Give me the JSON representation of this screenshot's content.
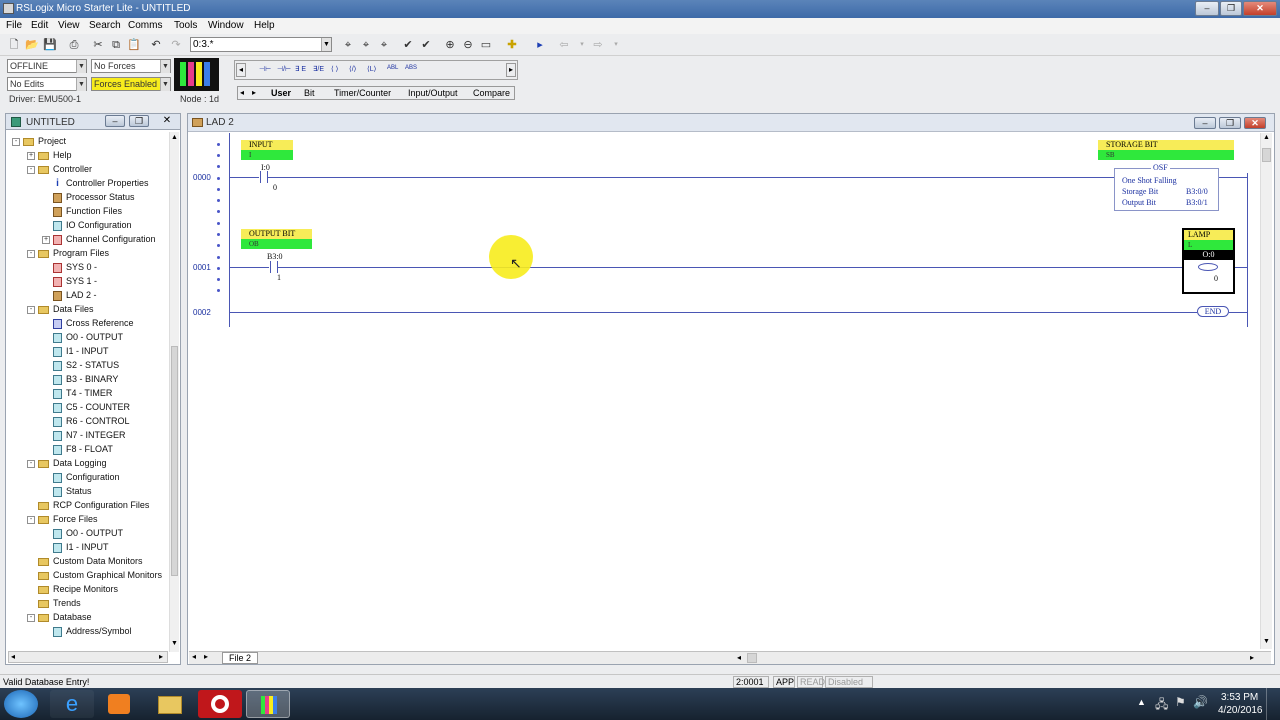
{
  "window": {
    "title": "RSLogix Micro Starter Lite - UNTITLED"
  },
  "menu": [
    "File",
    "Edit",
    "View",
    "Search",
    "Comms",
    "Tools",
    "Window",
    "Help"
  ],
  "toolbar": {
    "address_value": "0:3.*"
  },
  "status_panel": {
    "mode": "OFFLINE",
    "forces": "No Forces",
    "edits": "No Edits",
    "forces_enabled": "Forces Enabled",
    "driver": "Driver: EMU500-1",
    "node": "Node : 1d"
  },
  "instr_buttons": [
    "⊣⊢",
    "⊣/⊢",
    "∃ E",
    "∃/E",
    "⟨ ⟩",
    "⟨/⟩",
    "⟨L⟩",
    "ABL",
    "ABS"
  ],
  "instr_tabs": [
    "User",
    "Bit",
    "Timer/Counter",
    "Input/Output",
    "Compare"
  ],
  "project_panel": {
    "title": "UNTITLED",
    "tree": [
      {
        "label": "Project",
        "level": 0,
        "icon": "folder",
        "exp": "-"
      },
      {
        "label": "Help",
        "level": 1,
        "icon": "folder",
        "exp": "+"
      },
      {
        "label": "Controller",
        "level": 1,
        "icon": "folder",
        "exp": "-"
      },
      {
        "label": "Controller Properties",
        "level": 2,
        "icon": "info"
      },
      {
        "label": "Processor Status",
        "level": 2,
        "icon": "ladder"
      },
      {
        "label": "Function Files",
        "level": 2,
        "icon": "ladder"
      },
      {
        "label": "IO Configuration",
        "level": 2,
        "icon": "file"
      },
      {
        "label": "Channel Configuration",
        "level": 2,
        "icon": "sys",
        "exp": "+"
      },
      {
        "label": "Program Files",
        "level": 1,
        "icon": "folder",
        "exp": "-"
      },
      {
        "label": "SYS 0 -",
        "level": 2,
        "icon": "sys"
      },
      {
        "label": "SYS 1 -",
        "level": 2,
        "icon": "sys"
      },
      {
        "label": "LAD 2 -",
        "level": 2,
        "icon": "ladder"
      },
      {
        "label": "Data Files",
        "level": 1,
        "icon": "folder",
        "exp": "-"
      },
      {
        "label": "Cross Reference",
        "level": 2,
        "icon": "xref"
      },
      {
        "label": "O0 - OUTPUT",
        "level": 2,
        "icon": "file"
      },
      {
        "label": "I1 - INPUT",
        "level": 2,
        "icon": "file"
      },
      {
        "label": "S2 - STATUS",
        "level": 2,
        "icon": "file"
      },
      {
        "label": "B3 - BINARY",
        "level": 2,
        "icon": "file"
      },
      {
        "label": "T4 - TIMER",
        "level": 2,
        "icon": "file"
      },
      {
        "label": "C5 - COUNTER",
        "level": 2,
        "icon": "file"
      },
      {
        "label": "R6 - CONTROL",
        "level": 2,
        "icon": "file"
      },
      {
        "label": "N7 - INTEGER",
        "level": 2,
        "icon": "file"
      },
      {
        "label": "F8 - FLOAT",
        "level": 2,
        "icon": "file"
      },
      {
        "label": "Data Logging",
        "level": 1,
        "icon": "folder",
        "exp": "-"
      },
      {
        "label": "Configuration",
        "level": 2,
        "icon": "file"
      },
      {
        "label": "Status",
        "level": 2,
        "icon": "file"
      },
      {
        "label": "RCP Configuration Files",
        "level": 1,
        "icon": "folder"
      },
      {
        "label": "Force Files",
        "level": 1,
        "icon": "folder",
        "exp": "-"
      },
      {
        "label": "O0 - OUTPUT",
        "level": 2,
        "icon": "file"
      },
      {
        "label": "I1 - INPUT",
        "level": 2,
        "icon": "file"
      },
      {
        "label": "Custom Data Monitors",
        "level": 1,
        "icon": "folder"
      },
      {
        "label": "Custom Graphical Monitors",
        "level": 1,
        "icon": "folder"
      },
      {
        "label": "Recipe Monitors",
        "level": 1,
        "icon": "folder"
      },
      {
        "label": "Trends",
        "level": 1,
        "icon": "folder"
      },
      {
        "label": "Database",
        "level": 1,
        "icon": "folder",
        "exp": "-"
      },
      {
        "label": "Address/Symbol",
        "level": 2,
        "icon": "file"
      }
    ]
  },
  "ladder": {
    "title": "LAD 2",
    "file_tab": "File 2",
    "rung0": {
      "num": "0000",
      "input_tag": "INPUT",
      "input_sym": "I",
      "input_addr": "I:0",
      "input_bit": "0",
      "out_tag": "STORAGE BIT",
      "out_sym": "SB",
      "osf_name": "OSF",
      "osf_title": "One Shot Falling",
      "osf_storage_label": "Storage Bit",
      "osf_storage_val": "B3:0/0",
      "osf_output_label": "Output Bit",
      "osf_output_val": "B3:0/1"
    },
    "rung1": {
      "num": "0001",
      "input_tag": "OUTPUT BIT",
      "input_sym": "OB",
      "input_addr": "B3:0",
      "input_bit": "1",
      "out_tag": "LAMP",
      "out_sym": "L",
      "out_addr": "O:0",
      "out_bit": "0"
    },
    "rung2": {
      "num": "0002",
      "end_label": "END"
    }
  },
  "statusbar": {
    "message": "Valid Database Entry!",
    "rung_pos": "2:0001",
    "app": "APP",
    "read": "READ",
    "disabled": "Disabled"
  },
  "taskbar": {
    "time": "3:53 PM",
    "date": "4/20/2016"
  },
  "colors": {
    "titlebar": "#3d6aa8",
    "tag_yellow": "#f7ec58",
    "tag_green": "#2fe83c",
    "rung": "#4a56b4",
    "highlight": "#f7ec1d"
  }
}
